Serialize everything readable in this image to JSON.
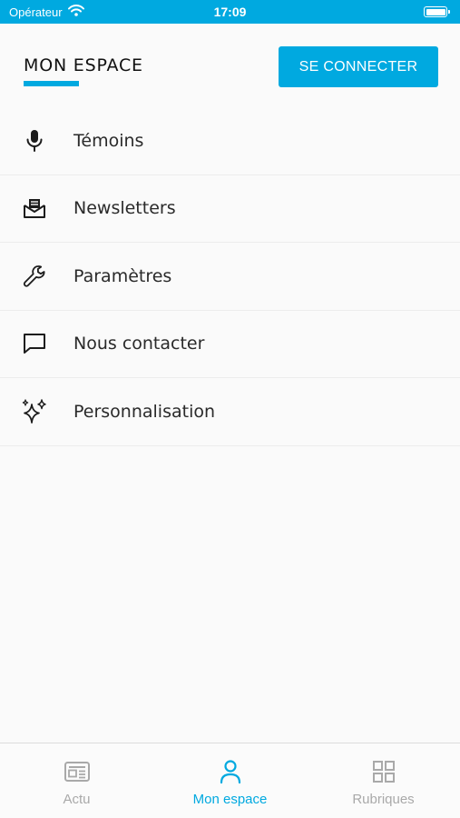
{
  "status_bar": {
    "carrier": "Opérateur",
    "time": "17:09"
  },
  "header": {
    "title": "MON ESPACE",
    "login_label": "SE CONNECTER"
  },
  "menu": {
    "items": [
      {
        "label": "Témoins",
        "icon": "microphone-icon"
      },
      {
        "label": "Newsletters",
        "icon": "mail-envelope-icon"
      },
      {
        "label": "Paramètres",
        "icon": "wrench-icon"
      },
      {
        "label": "Nous contacter",
        "icon": "chat-bubble-icon"
      },
      {
        "label": "Personnalisation",
        "icon": "sparkles-icon"
      }
    ]
  },
  "tab_bar": {
    "tabs": [
      {
        "label": "Actu",
        "icon": "newspaper-icon",
        "active": false
      },
      {
        "label": "Mon espace",
        "icon": "person-icon",
        "active": true
      },
      {
        "label": "Rubriques",
        "icon": "grid-icon",
        "active": false
      }
    ]
  },
  "colors": {
    "accent": "#00a9e0",
    "inactive_tab": "#a9a9a9",
    "background": "#fafafa"
  }
}
